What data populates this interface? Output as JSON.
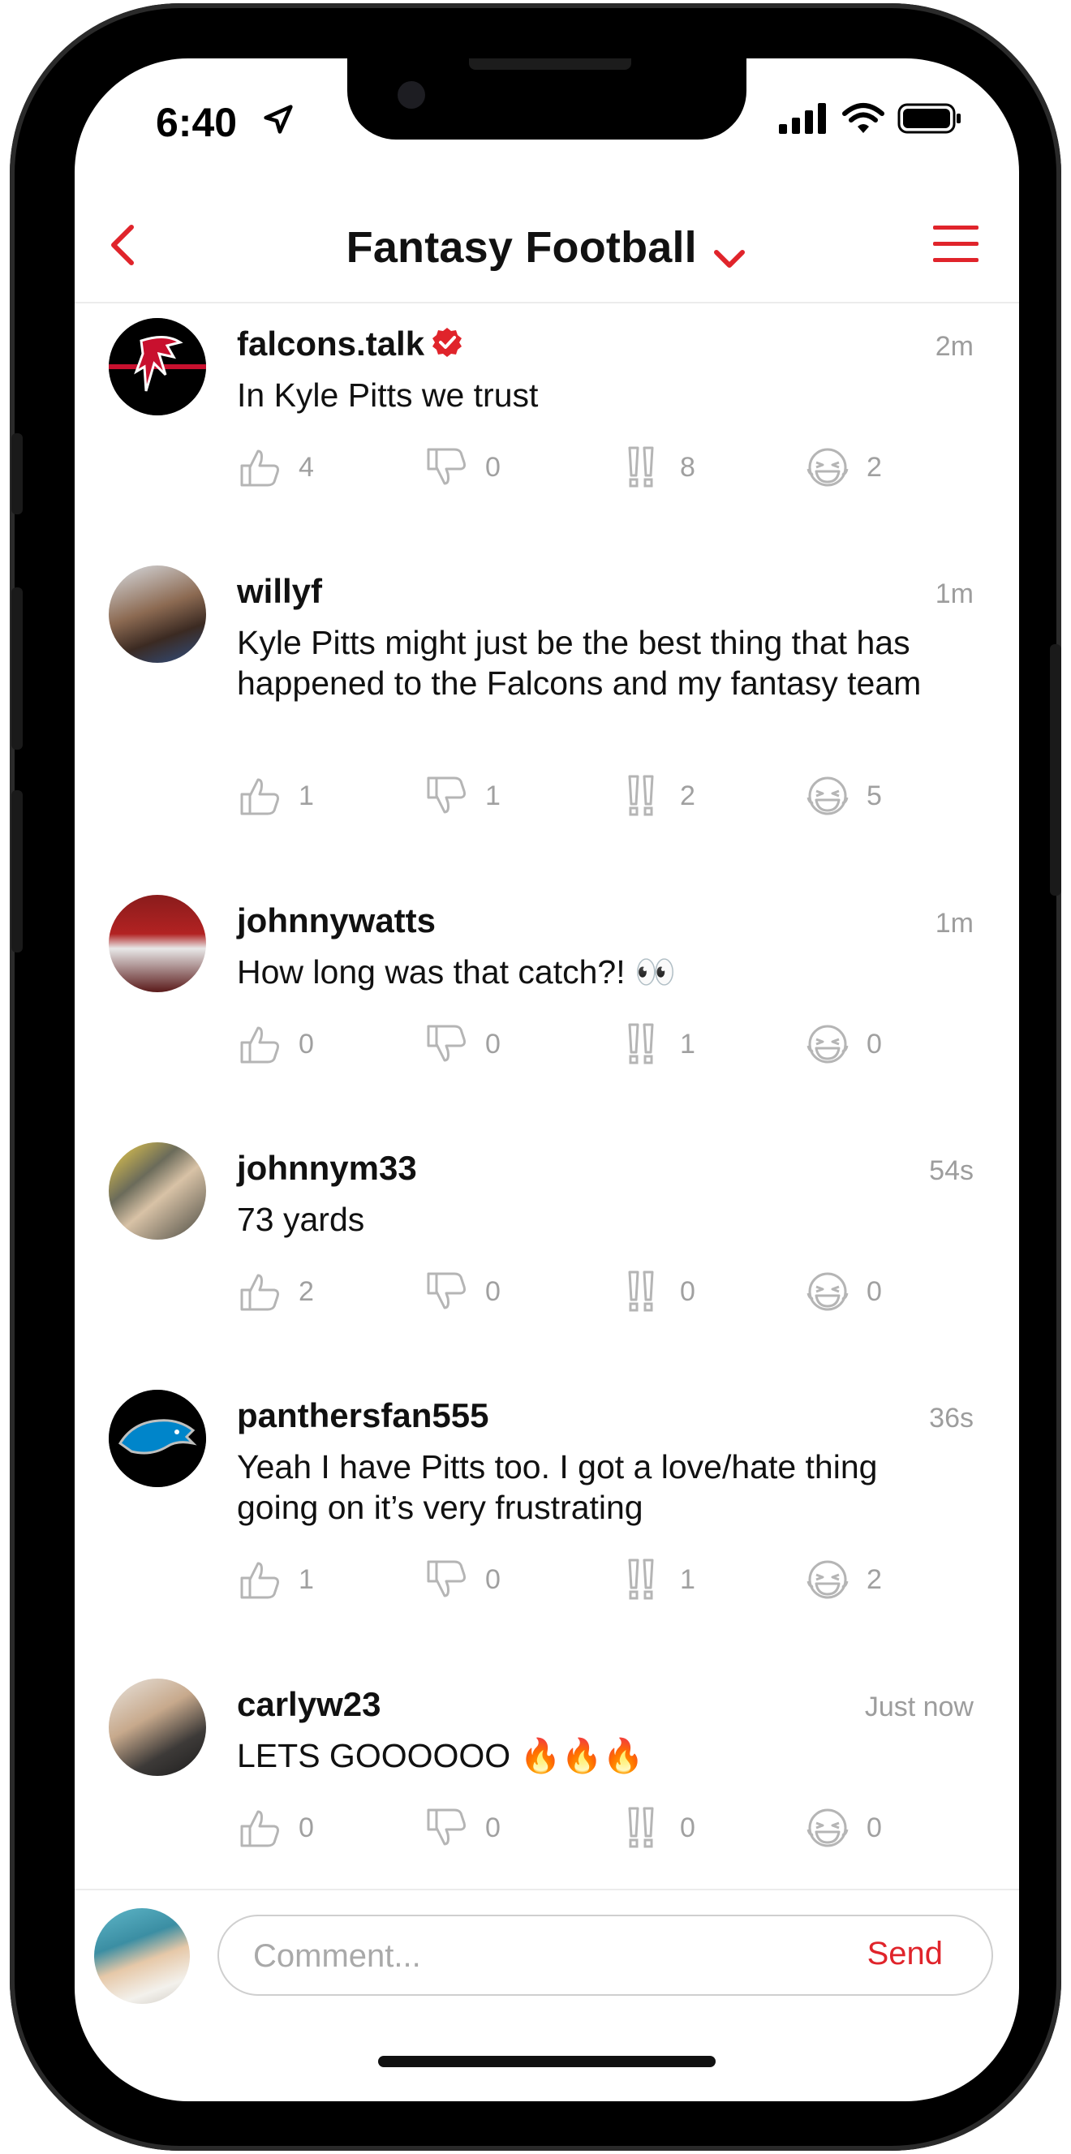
{
  "status_bar": {
    "time": "6:40"
  },
  "header": {
    "title": "Fantasy Football"
  },
  "colors": {
    "accent": "#e0242b",
    "muted": "#a0a0a0"
  },
  "posts": [
    {
      "username": "falcons.talk",
      "verified": true,
      "time": "2m",
      "text": "In Kyle Pitts we trust",
      "reactions": {
        "like": "4",
        "dislike": "0",
        "wow": "8",
        "laugh": "2"
      }
    },
    {
      "username": "willyf",
      "verified": false,
      "time": "1m",
      "text": "Kyle Pitts might just be the best thing that has happened to the Falcons and my fantasy team",
      "reactions": {
        "like": "1",
        "dislike": "1",
        "wow": "2",
        "laugh": "5"
      }
    },
    {
      "username": "johnnywatts",
      "verified": false,
      "time": "1m",
      "text": "How long was that catch?! 👀",
      "reactions": {
        "like": "0",
        "dislike": "0",
        "wow": "1",
        "laugh": "0"
      }
    },
    {
      "username": "johnnym33",
      "verified": false,
      "time": "54s",
      "text": "73 yards",
      "reactions": {
        "like": "2",
        "dislike": "0",
        "wow": "0",
        "laugh": "0"
      }
    },
    {
      "username": "panthersfan555",
      "verified": false,
      "time": "36s",
      "text": "Yeah I have Pitts too. I got a love/hate thing going on it’s very frustrating",
      "reactions": {
        "like": "1",
        "dislike": "0",
        "wow": "1",
        "laugh": "2"
      }
    },
    {
      "username": "carlyw23",
      "verified": false,
      "time": "Just now",
      "text": "LETS GOOOOOO 🔥🔥🔥",
      "reactions": {
        "like": "0",
        "dislike": "0",
        "wow": "0",
        "laugh": "0"
      }
    }
  ],
  "composer": {
    "placeholder": "Comment...",
    "send_label": "Send"
  }
}
